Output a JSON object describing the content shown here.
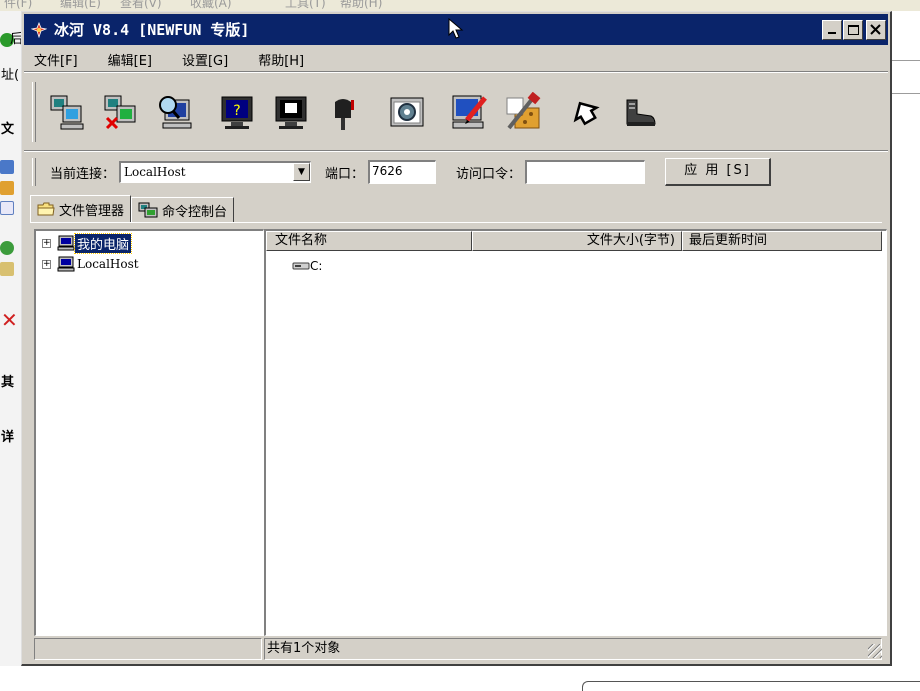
{
  "background": {
    "menu_items": [
      "件(F)",
      "编辑(E)",
      "查看(V)",
      "收藏(A)",
      "工具(T)",
      "帮助(H)"
    ],
    "sidebar_texts": [
      "后",
      "址(",
      "文",
      "其",
      "详"
    ]
  },
  "window": {
    "title": "冰河 V8.4 [NEWFUN 专版]",
    "title_buttons": {
      "minimize": "_",
      "maximize": "□",
      "close": "×"
    }
  },
  "menu": [
    {
      "label": "文件[F]"
    },
    {
      "label": "编辑[E]"
    },
    {
      "label": "设置[G]"
    },
    {
      "label": "帮助[H]"
    }
  ],
  "toolbar": {
    "icons": [
      "add-host-icon",
      "delete-host-icon",
      "search-host-icon",
      "help-screen-icon",
      "screen-capture-icon",
      "mailbox-icon",
      "settings-gear-icon",
      "config-edit-icon",
      "tools-icon",
      "home-icon",
      "boot-icon"
    ]
  },
  "connection": {
    "current_label": "当前连接：",
    "current_value": "LocalHost",
    "port_label": "端口：",
    "port_value": "7626",
    "password_label": "访问口令：",
    "password_value": "",
    "apply_label": "应 用 [S]"
  },
  "tabs": [
    {
      "label": "文件管理器",
      "icon": "folder-icon",
      "active": true
    },
    {
      "label": "命令控制台",
      "icon": "console-icon",
      "active": false
    }
  ],
  "tree": [
    {
      "label": "我的电脑",
      "selected": true
    },
    {
      "label": "LocalHost",
      "selected": false
    }
  ],
  "file_list": {
    "columns": [
      "文件名称",
      "文件大小(字节)",
      "最后更新时间"
    ],
    "rows": [
      {
        "name": "C:",
        "icon": "drive-icon"
      }
    ]
  },
  "status": {
    "text": "共有1个对象"
  }
}
